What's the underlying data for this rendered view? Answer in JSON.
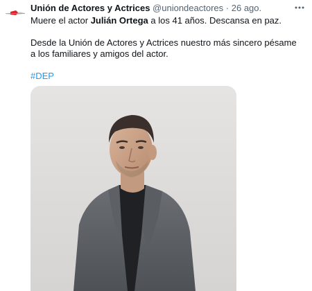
{
  "tweet": {
    "author_name": "Unión de Actores y Actrices",
    "handle": "@uniondeactores",
    "separator": "·",
    "time": "26 ago.",
    "text_intro": "Muere el actor ",
    "text_bold": "Julián Ortega",
    "text_rest": " a los 41 años. Descansa en paz.",
    "paragraph2": "Desde la Unión de Actores y Actrices nuestro más sincero pésame a los familiares y amigos del actor.",
    "hashtag": "#DEP"
  },
  "icons": {
    "avatar": "union-logo-icon",
    "more": "more-options-icon"
  },
  "colors": {
    "text": "#0f1419",
    "secondary": "#536471",
    "link": "#1d9bf0",
    "logo_red": "#d8262e"
  }
}
